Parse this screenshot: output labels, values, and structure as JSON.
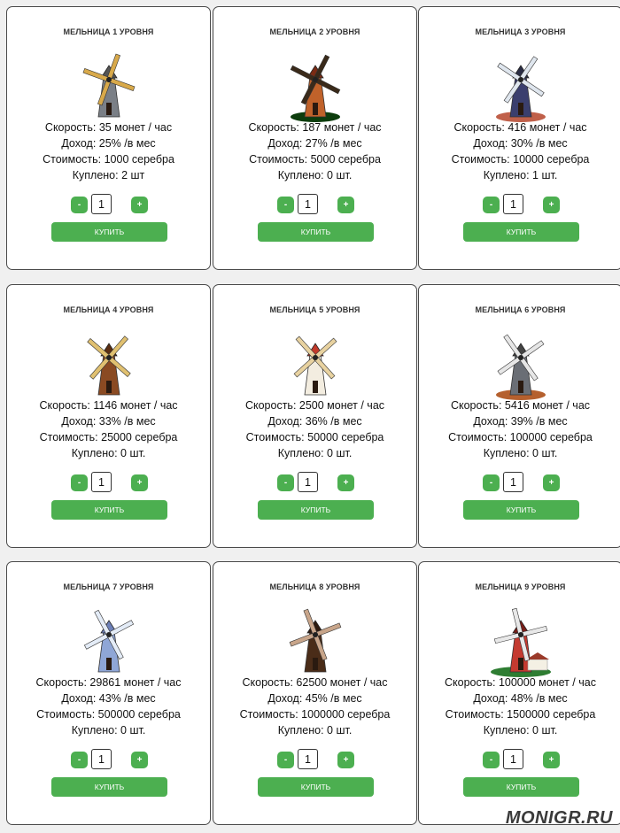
{
  "colors": {
    "accent": "#4caf50",
    "card_border": "#4a4a4a",
    "page_bg": "#f0f0f0"
  },
  "labels": {
    "speed_prefix": "Скорость:",
    "income_prefix": "Доход:",
    "cost_prefix": "Стоимость:",
    "bought_prefix": "Куплено:"
  },
  "cards": [
    {
      "title": "МЕЛЬНИЦА 1 УРОВНЯ",
      "icon": "windmill-level-1-icon",
      "speed": "Скорость: 35 монет / час",
      "income": "Доход: 25% /в мес",
      "cost": "Стоимость: 1000 серебра",
      "bought": "Куплено: 2 шт",
      "qty": "1",
      "minus": "-",
      "plus": "+",
      "buy": "КУПИТЬ"
    },
    {
      "title": "МЕЛЬНИЦА 2 УРОВНЯ",
      "icon": "windmill-level-2-icon",
      "speed": "Скорость: 187 монет / час",
      "income": "Доход: 27% /в мес",
      "cost": "Стоимость: 5000 серебра",
      "bought": "Куплено: 0 шт.",
      "qty": "1",
      "minus": "-",
      "plus": "+",
      "buy": "КУПИТЬ"
    },
    {
      "title": "МЕЛЬНИЦА 3 УРОВНЯ",
      "icon": "windmill-level-3-icon",
      "speed": "Скорость: 416 монет / час",
      "income": "Доход: 30% /в мес",
      "cost": "Стоимость: 10000 серебра",
      "bought": "Куплено: 1 шт.",
      "qty": "1",
      "minus": "-",
      "plus": "+",
      "buy": "КУПИТЬ"
    },
    {
      "title": "МЕЛЬНИЦА 4 УРОВНЯ",
      "icon": "windmill-level-4-icon",
      "speed": "Скорость: 1146 монет / час",
      "income": "Доход: 33% /в мес",
      "cost": "Стоимость: 25000 серебра",
      "bought": "Куплено: 0 шт.",
      "qty": "1",
      "minus": "-",
      "plus": "+",
      "buy": "КУПИТЬ"
    },
    {
      "title": "МЕЛЬНИЦА 5 УРОВНЯ",
      "icon": "windmill-level-5-icon",
      "speed": "Скорость: 2500 монет / час",
      "income": "Доход: 36% /в мес",
      "cost": "Стоимость: 50000 серебра",
      "bought": "Куплено: 0 шт.",
      "qty": "1",
      "minus": "-",
      "plus": "+",
      "buy": "КУПИТЬ"
    },
    {
      "title": "МЕЛЬНИЦА 6 УРОВНЯ",
      "icon": "windmill-level-6-icon",
      "speed": "Скорость: 5416 монет / час",
      "income": "Доход: 39% /в мес",
      "cost": "Стоимость: 100000 серебра",
      "bought": "Куплено: 0 шт.",
      "qty": "1",
      "minus": "-",
      "plus": "+",
      "buy": "КУПИТЬ"
    },
    {
      "title": "МЕЛЬНИЦА 7 УРОВНЯ",
      "icon": "windmill-level-7-icon",
      "speed": "Скорость: 29861 монет / час",
      "income": "Доход: 43% /в мес",
      "cost": "Стоимость: 500000 серебра",
      "bought": "Куплено: 0 шт.",
      "qty": "1",
      "minus": "-",
      "plus": "+",
      "buy": "КУПИТЬ"
    },
    {
      "title": "МЕЛЬНИЦА 8 УРОВНЯ",
      "icon": "windmill-level-8-icon",
      "speed": "Скорость: 62500 монет / час",
      "income": "Доход: 45% /в мес",
      "cost": "Стоимость: 1000000 серебра",
      "bought": "Куплено: 0 шт.",
      "qty": "1",
      "minus": "-",
      "plus": "+",
      "buy": "КУПИТЬ"
    },
    {
      "title": "МЕЛЬНИЦА 9 УРОВНЯ",
      "icon": "windmill-level-9-icon",
      "speed": "Скорость: 100000 монет / час",
      "income": "Доход: 48% /в мес",
      "cost": "Стоимость: 1500000 серебра",
      "bought": "Куплено: 0 шт.",
      "qty": "1",
      "minus": "-",
      "plus": "+",
      "buy": "КУПИТЬ"
    }
  ],
  "watermark": "MONIGR.RU"
}
